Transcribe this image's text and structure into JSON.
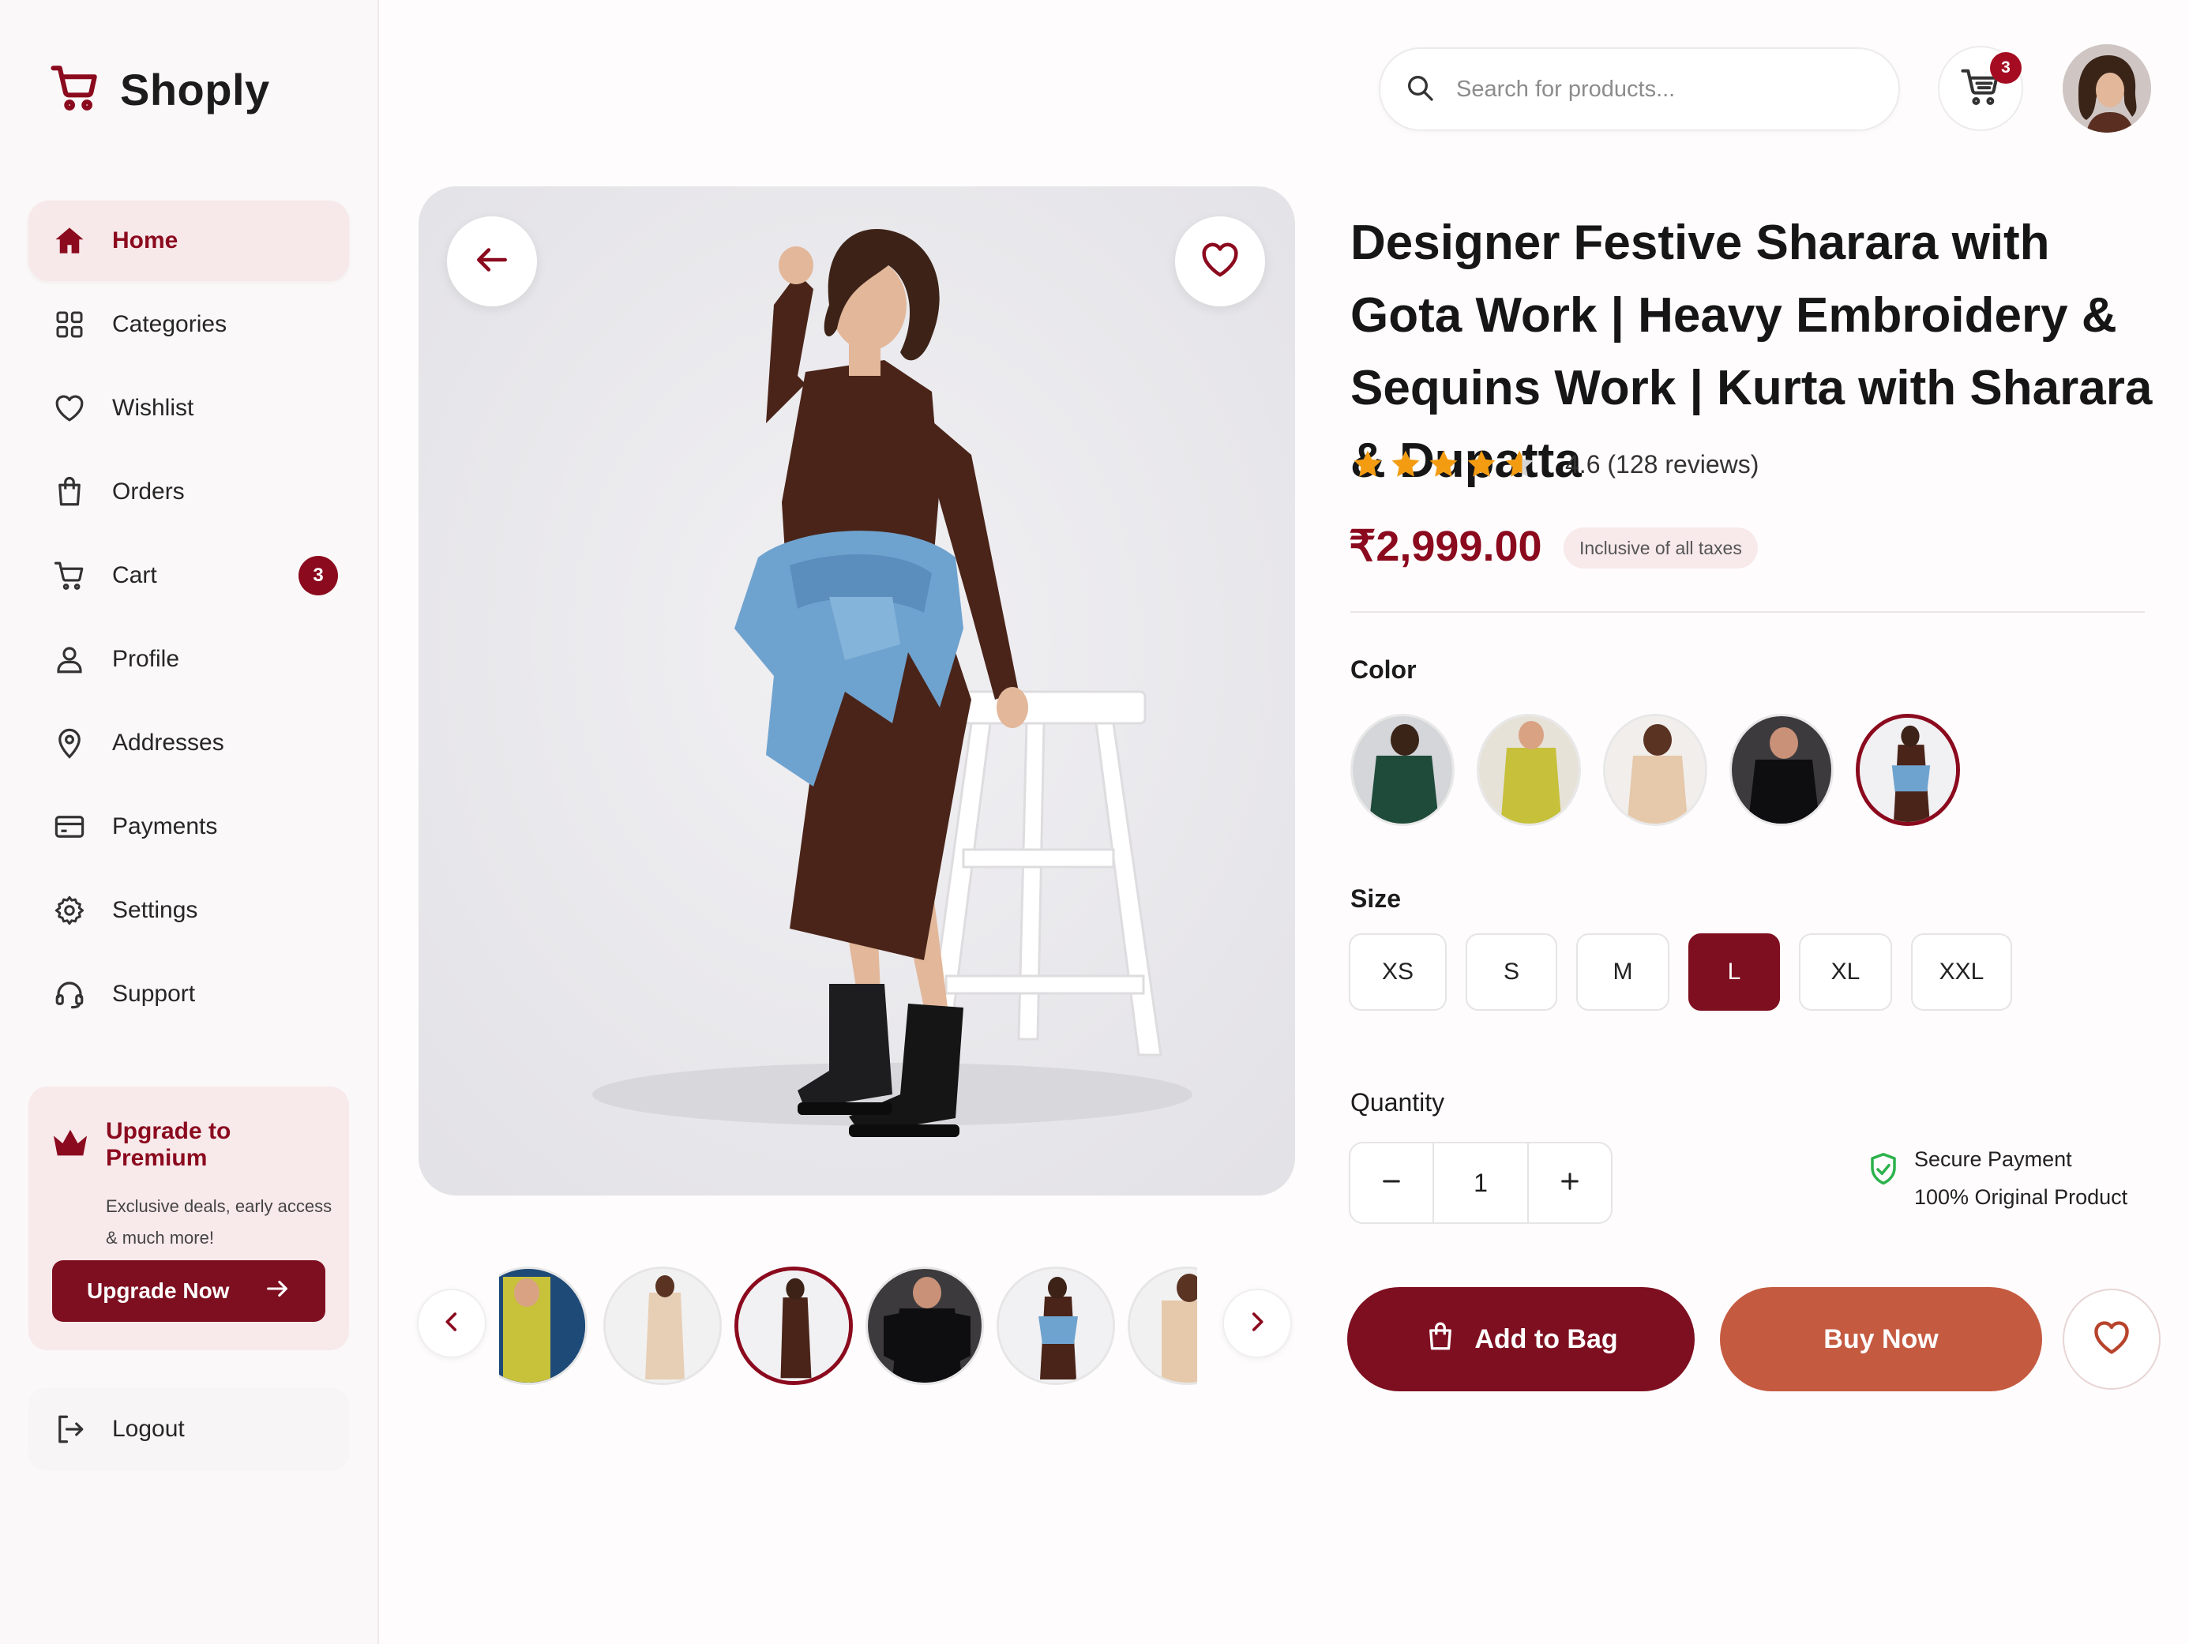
{
  "app": {
    "name": "Shoply"
  },
  "sidebar": {
    "items": [
      {
        "label": "Home",
        "icon": "home-icon",
        "active": true
      },
      {
        "label": "Categories",
        "icon": "grid-icon"
      },
      {
        "label": "Wishlist",
        "icon": "heart-icon"
      },
      {
        "label": "Orders",
        "icon": "bag-icon"
      },
      {
        "label": "Cart",
        "icon": "cart-icon",
        "badge": "3"
      },
      {
        "label": "Profile",
        "icon": "user-icon"
      },
      {
        "label": "Addresses",
        "icon": "location-pin-icon"
      },
      {
        "label": "Payments",
        "icon": "credit-card-icon"
      },
      {
        "label": "Settings",
        "icon": "gear-icon"
      },
      {
        "label": "Support",
        "icon": "headset-icon"
      }
    ],
    "premium": {
      "title": "Upgrade to Premium",
      "description": "Exclusive deals, early access & much more!",
      "button": "Upgrade Now"
    },
    "logout": "Logout"
  },
  "header": {
    "search_placeholder": "Search for products...",
    "cart_count": "3"
  },
  "product": {
    "title": "Designer Festive Sharara with Gota Work |  Heavy Embroidery & Sequins Work |  Kurta with Sharara & Dupatta",
    "rating": 4.6,
    "rating_text": "4.6 (128 reviews)",
    "price": "₹2,999.00",
    "tax_note": "Inclusive of all taxes",
    "color_label": "Color",
    "colors": [
      "dark-green",
      "lime",
      "beige",
      "black",
      "brown-denim"
    ],
    "selected_color": 4,
    "size_label": "Size",
    "sizes": [
      "XS",
      "S",
      "M",
      "L",
      "XL",
      "XXL"
    ],
    "selected_size": "L",
    "quantity_label": "Quantity",
    "quantity": "1",
    "trust": [
      "Secure Payment",
      "100% Original Product"
    ],
    "actions": {
      "add_to_bag": "Add to Bag",
      "buy_now": "Buy Now"
    }
  },
  "colors": {
    "primary": "#7e0f20",
    "accent": "#c45a40",
    "star": "#f39c12",
    "trust": "#2bb24c"
  }
}
